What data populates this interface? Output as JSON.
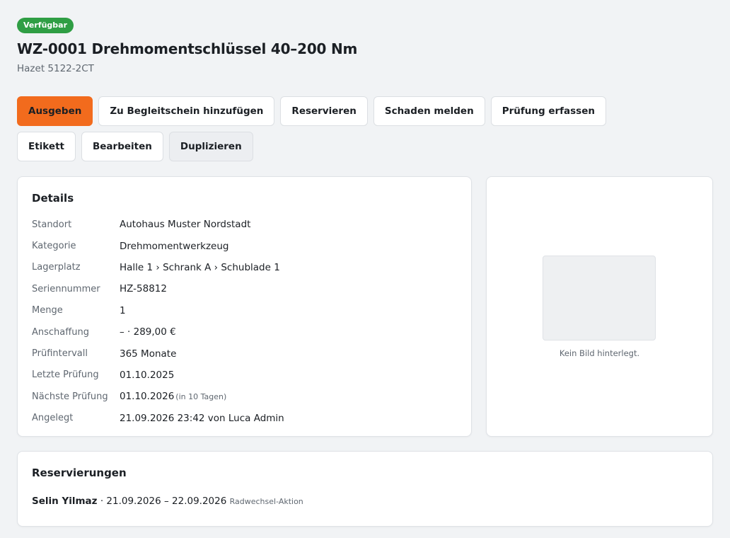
{
  "header": {
    "status_badge": "Verfügbar",
    "title": "WZ-0001 Drehmomentschlüssel 40–200 Nm",
    "subtitle": "Hazet 5122-2CT"
  },
  "actions": {
    "checkout": "Ausgeben",
    "add_to_delivery_note": "Zu Begleitschein hinzufügen",
    "reserve": "Reservieren",
    "report_damage": "Schaden melden",
    "record_inspection": "Prüfung erfassen",
    "label": "Etikett",
    "edit": "Bearbeiten",
    "duplicate": "Duplizieren"
  },
  "colors": {
    "primary_button": "#f26b1d",
    "status_badge": "#2f9e44"
  },
  "details": {
    "title": "Details",
    "rows": [
      {
        "key": "Standort",
        "value": "Autohaus Muster Nordstadt"
      },
      {
        "key": "Kategorie",
        "value": "Drehmomentwerkzeug"
      },
      {
        "key": "Lagerplatz",
        "value": "Halle 1 › Schrank A › Schublade 1"
      },
      {
        "key": "Seriennummer",
        "value": "HZ-58812"
      },
      {
        "key": "Menge",
        "value": "1"
      },
      {
        "key": "Anschaffung",
        "value": "– · 289,00 €"
      },
      {
        "key": "Prüfintervall",
        "value": "365 Monate"
      },
      {
        "key": "Letzte Prüfung",
        "value": "01.10.2025"
      },
      {
        "key": "Nächste Prüfung",
        "value": "01.10.2026",
        "note": "(in 10 Tagen)"
      },
      {
        "key": "Angelegt",
        "value": "21.09.2026 23:42 von Luca Admin"
      }
    ]
  },
  "image": {
    "caption": "Kein Bild hinterlegt."
  },
  "reservations": {
    "title": "Reservierungen",
    "items": [
      {
        "name": "Selin Yilmaz",
        "range": "· 21.09.2026 – 22.09.2026",
        "note": "Radwechsel-Aktion"
      }
    ]
  }
}
